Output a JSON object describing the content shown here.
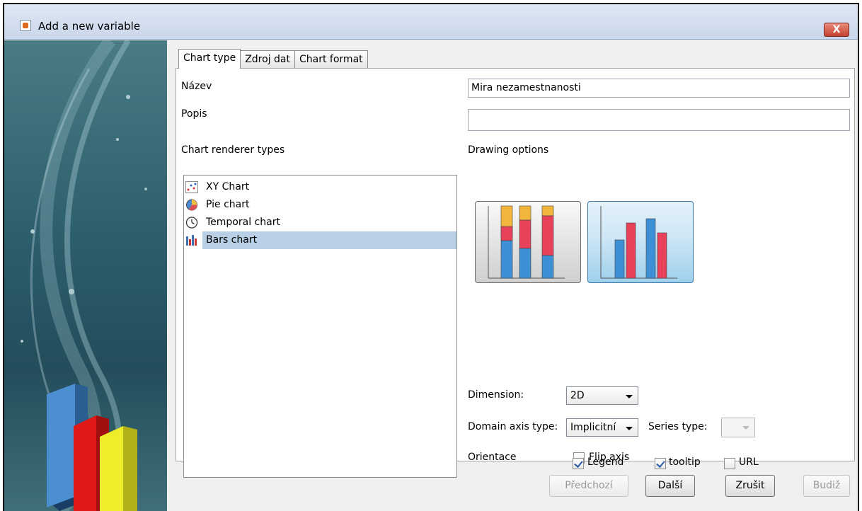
{
  "window": {
    "title": "Add a new variable",
    "close_label": "X"
  },
  "tabs": [
    {
      "label": "Chart type"
    },
    {
      "label": "Zdroj dat"
    },
    {
      "label": "Chart format"
    }
  ],
  "form": {
    "name_label": "Název",
    "name_value": "Mira nezamestnanosti",
    "description_label": "Popis",
    "description_value": ""
  },
  "renderer": {
    "label": "Chart renderer types",
    "items": [
      {
        "label": "XY Chart",
        "icon": "xy-chart-icon"
      },
      {
        "label": "Pie chart",
        "icon": "pie-chart-icon"
      },
      {
        "label": "Temporal chart",
        "icon": "clock-icon"
      },
      {
        "label": "Bars chart",
        "icon": "bar-chart-icon"
      }
    ],
    "selected": "Bars chart"
  },
  "drawing": {
    "label": "Drawing options",
    "options": [
      {
        "name": "stacked-bar",
        "selected": false
      },
      {
        "name": "grouped-bar",
        "selected": true
      }
    ]
  },
  "settings": {
    "dimension_label": "Dimension:",
    "dimension_value": "2D",
    "domain_axis_label": "Domain axis type:",
    "domain_axis_value": "Implicitní",
    "series_type_label": "Series type:",
    "series_type_value": "",
    "orientation_label": "Orientace",
    "flip_axis_label": "Flip axis",
    "flip_axis_checked": false,
    "legend_label": "Legend",
    "legend_checked": true,
    "tooltip_label": "tooltip",
    "tooltip_checked": true,
    "url_label": "URL",
    "url_checked": false
  },
  "buttons": {
    "previous": "Předchozí",
    "next": "Další",
    "cancel": "Zrušit",
    "finish": "Budiž"
  },
  "colors": {
    "selection": "#b8cfe5",
    "bar_blue": "#3d8fd6",
    "bar_red": "#e8415a",
    "bar_yellow": "#f3b63c"
  }
}
